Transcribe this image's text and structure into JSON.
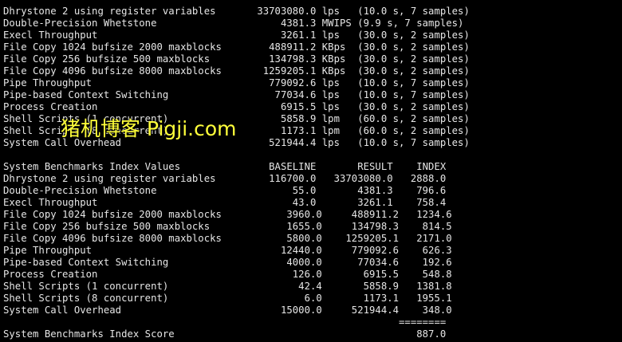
{
  "terminal": {
    "results": [
      "Dhrystone 2 using register variables       33703080.0 lps   (10.0 s, 7 samples)",
      "Double-Precision Whetstone                     4381.3 MWIPS (9.9 s, 7 samples)",
      "Execl Throughput                               3261.1 lps   (30.0 s, 2 samples)",
      "File Copy 1024 bufsize 2000 maxblocks        488911.2 KBps  (30.0 s, 2 samples)",
      "File Copy 256 bufsize 500 maxblocks          134798.3 KBps  (30.0 s, 2 samples)",
      "File Copy 4096 bufsize 8000 maxblocks       1259205.1 KBps  (30.0 s, 2 samples)",
      "Pipe Throughput                              779092.6 lps   (10.0 s, 7 samples)",
      "Pipe-based Context Switching                  77034.6 lps   (10.0 s, 7 samples)",
      "Process Creation                               6915.5 lps   (30.0 s, 2 samples)",
      "Shell Scripts (1 concurrent)                   5858.9 lpm   (60.0 s, 2 samples)",
      "Shell Scripts (8 concurrent)                   1173.1 lpm   (60.0 s, 2 samples)",
      "System Call Overhead                         521944.4 lps   (10.0 s, 7 samples)"
    ],
    "index_table": [
      "System Benchmarks Index Values               BASELINE       RESULT    INDEX",
      "Dhrystone 2 using register variables         116700.0   33703080.0   2888.0",
      "Double-Precision Whetstone                       55.0       4381.3    796.6",
      "Execl Throughput                                 43.0       3261.1    758.4",
      "File Copy 1024 bufsize 2000 maxblocks           3960.0     488911.2   1234.6",
      "File Copy 256 bufsize 500 maxblocks             1655.0     134798.3    814.5",
      "File Copy 4096 bufsize 8000 maxblocks           5800.0    1259205.1   2171.0",
      "Pipe Throughput                                12440.0     779092.6    626.3",
      "Pipe-based Context Switching                    4000.0      77034.6    192.6",
      "Process Creation                                 126.0       6915.5    548.8",
      "Shell Scripts (1 concurrent)                      42.4       5858.9   1381.8",
      "Shell Scripts (8 concurrent)                       6.0       1173.1   1955.1",
      "System Call Overhead                           15000.0     521944.4    348.0",
      "                                                                   ========",
      "System Benchmarks Index Score                                         887.0"
    ]
  },
  "watermark": {
    "text": "猪机博客 Pigji.com"
  },
  "colors": {
    "background": "#000000",
    "text": "#e6e6e6",
    "watermark": "#ffff3a"
  }
}
